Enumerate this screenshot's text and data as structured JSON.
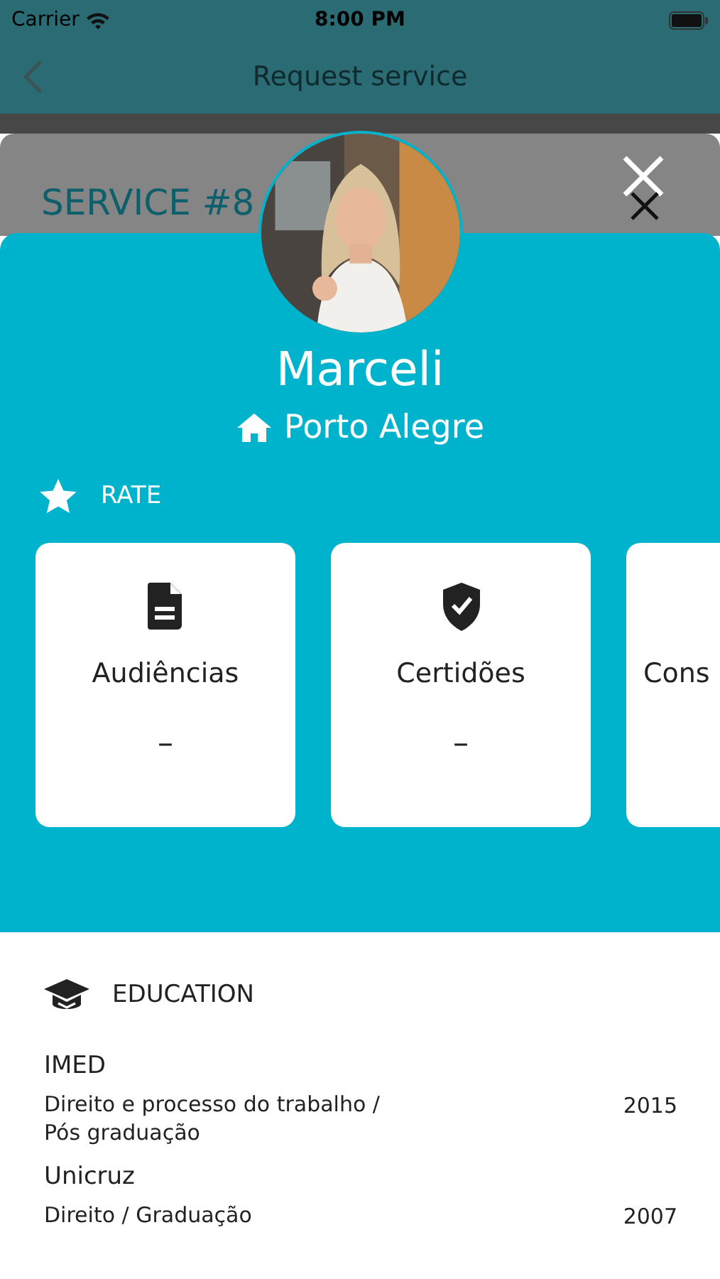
{
  "status_bar": {
    "carrier": "Carrier",
    "time": "8:00 PM"
  },
  "nav_bar": {
    "title": "Request service"
  },
  "sheet": {
    "title": "SERVICE #8"
  },
  "profile": {
    "name": "Marceli",
    "city": "Porto Alegre"
  },
  "rate": {
    "heading": "RATE",
    "cards": [
      {
        "kind": "document",
        "label": "Audiências",
        "value": "–"
      },
      {
        "kind": "shield",
        "label": "Certidões",
        "value": "–"
      },
      {
        "kind": "none",
        "label": "Cons"
      }
    ]
  },
  "education": {
    "heading": "EDUCATION",
    "items": [
      {
        "school": "IMED",
        "course": "Direito e processo do trabalho  / Pós graduação",
        "year": "2015"
      },
      {
        "school": "Unicruz",
        "course": "Direito  / Graduação",
        "year": "2007"
      }
    ]
  }
}
